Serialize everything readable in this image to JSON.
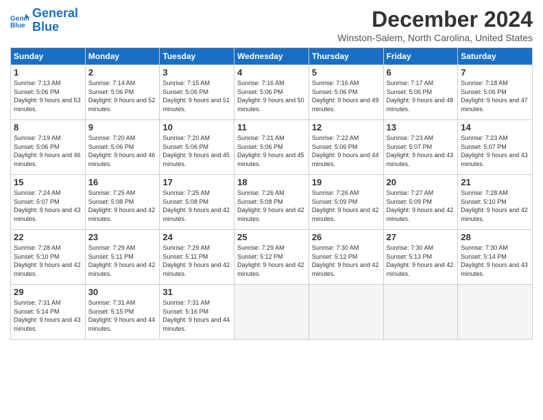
{
  "logo": {
    "line1": "General",
    "line2": "Blue"
  },
  "title": "December 2024",
  "location": "Winston-Salem, North Carolina, United States",
  "headers": [
    "Sunday",
    "Monday",
    "Tuesday",
    "Wednesday",
    "Thursday",
    "Friday",
    "Saturday"
  ],
  "weeks": [
    [
      {
        "day": "1",
        "sunrise": "7:13 AM",
        "sunset": "5:06 PM",
        "daylight": "9 hours and 53 minutes."
      },
      {
        "day": "2",
        "sunrise": "7:14 AM",
        "sunset": "5:06 PM",
        "daylight": "9 hours and 52 minutes."
      },
      {
        "day": "3",
        "sunrise": "7:15 AM",
        "sunset": "5:06 PM",
        "daylight": "9 hours and 51 minutes."
      },
      {
        "day": "4",
        "sunrise": "7:16 AM",
        "sunset": "5:06 PM",
        "daylight": "9 hours and 50 minutes."
      },
      {
        "day": "5",
        "sunrise": "7:16 AM",
        "sunset": "5:06 PM",
        "daylight": "9 hours and 49 minutes."
      },
      {
        "day": "6",
        "sunrise": "7:17 AM",
        "sunset": "5:06 PM",
        "daylight": "9 hours and 48 minutes."
      },
      {
        "day": "7",
        "sunrise": "7:18 AM",
        "sunset": "5:06 PM",
        "daylight": "9 hours and 47 minutes."
      }
    ],
    [
      {
        "day": "8",
        "sunrise": "7:19 AM",
        "sunset": "5:06 PM",
        "daylight": "9 hours and 46 minutes."
      },
      {
        "day": "9",
        "sunrise": "7:20 AM",
        "sunset": "5:06 PM",
        "daylight": "9 hours and 46 minutes."
      },
      {
        "day": "10",
        "sunrise": "7:20 AM",
        "sunset": "5:06 PM",
        "daylight": "9 hours and 45 minutes."
      },
      {
        "day": "11",
        "sunrise": "7:21 AM",
        "sunset": "5:06 PM",
        "daylight": "9 hours and 45 minutes."
      },
      {
        "day": "12",
        "sunrise": "7:22 AM",
        "sunset": "5:06 PM",
        "daylight": "9 hours and 44 minutes."
      },
      {
        "day": "13",
        "sunrise": "7:23 AM",
        "sunset": "5:07 PM",
        "daylight": "9 hours and 43 minutes."
      },
      {
        "day": "14",
        "sunrise": "7:23 AM",
        "sunset": "5:07 PM",
        "daylight": "9 hours and 43 minutes."
      }
    ],
    [
      {
        "day": "15",
        "sunrise": "7:24 AM",
        "sunset": "5:07 PM",
        "daylight": "9 hours and 43 minutes."
      },
      {
        "day": "16",
        "sunrise": "7:25 AM",
        "sunset": "5:08 PM",
        "daylight": "9 hours and 42 minutes."
      },
      {
        "day": "17",
        "sunrise": "7:25 AM",
        "sunset": "5:08 PM",
        "daylight": "9 hours and 42 minutes."
      },
      {
        "day": "18",
        "sunrise": "7:26 AM",
        "sunset": "5:08 PM",
        "daylight": "9 hours and 42 minutes."
      },
      {
        "day": "19",
        "sunrise": "7:26 AM",
        "sunset": "5:09 PM",
        "daylight": "9 hours and 42 minutes."
      },
      {
        "day": "20",
        "sunrise": "7:27 AM",
        "sunset": "5:09 PM",
        "daylight": "9 hours and 42 minutes."
      },
      {
        "day": "21",
        "sunrise": "7:28 AM",
        "sunset": "5:10 PM",
        "daylight": "9 hours and 42 minutes."
      }
    ],
    [
      {
        "day": "22",
        "sunrise": "7:28 AM",
        "sunset": "5:10 PM",
        "daylight": "9 hours and 42 minutes."
      },
      {
        "day": "23",
        "sunrise": "7:29 AM",
        "sunset": "5:11 PM",
        "daylight": "9 hours and 42 minutes."
      },
      {
        "day": "24",
        "sunrise": "7:29 AM",
        "sunset": "5:11 PM",
        "daylight": "9 hours and 42 minutes."
      },
      {
        "day": "25",
        "sunrise": "7:29 AM",
        "sunset": "5:12 PM",
        "daylight": "9 hours and 42 minutes."
      },
      {
        "day": "26",
        "sunrise": "7:30 AM",
        "sunset": "5:12 PM",
        "daylight": "9 hours and 42 minutes."
      },
      {
        "day": "27",
        "sunrise": "7:30 AM",
        "sunset": "5:13 PM",
        "daylight": "9 hours and 42 minutes."
      },
      {
        "day": "28",
        "sunrise": "7:30 AM",
        "sunset": "5:14 PM",
        "daylight": "9 hours and 43 minutes."
      }
    ],
    [
      {
        "day": "29",
        "sunrise": "7:31 AM",
        "sunset": "5:14 PM",
        "daylight": "9 hours and 43 minutes."
      },
      {
        "day": "30",
        "sunrise": "7:31 AM",
        "sunset": "5:15 PM",
        "daylight": "9 hours and 44 minutes."
      },
      {
        "day": "31",
        "sunrise": "7:31 AM",
        "sunset": "5:16 PM",
        "daylight": "9 hours and 44 minutes."
      },
      null,
      null,
      null,
      null
    ]
  ]
}
